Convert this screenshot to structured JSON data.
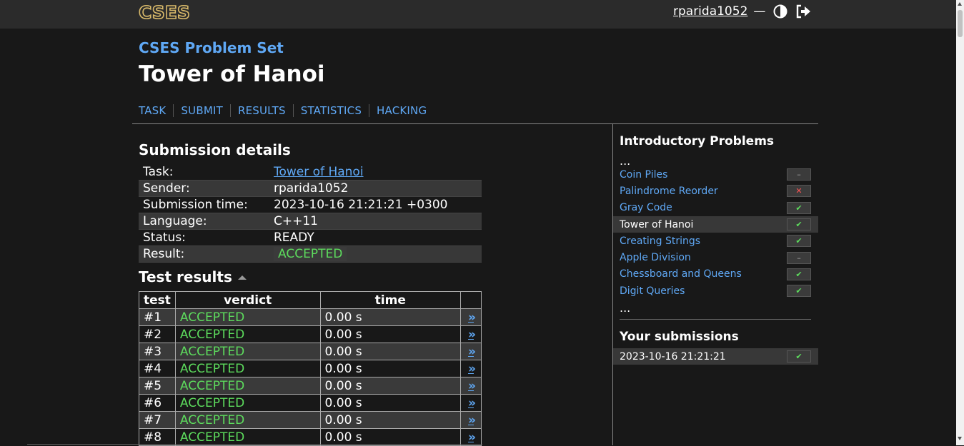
{
  "header": {
    "logo_text": "CSES",
    "username": "rparida1052",
    "dash": "—",
    "theme_icon": "contrast-icon",
    "logout_icon": "logout-icon"
  },
  "section_title": "CSES Problem Set",
  "page_title": "Tower of Hanoi",
  "nav": [
    "TASK",
    "SUBMIT",
    "RESULTS",
    "STATISTICS",
    "HACKING"
  ],
  "details": {
    "heading": "Submission details",
    "rows": [
      {
        "key": "Task:",
        "value": "Tower of Hanoi"
      },
      {
        "key": "Sender:",
        "value": "rparida1052"
      },
      {
        "key": "Submission time:",
        "value": "2023-10-16 21:21:21 +0300"
      },
      {
        "key": "Language:",
        "value": "C++11"
      },
      {
        "key": "Status:",
        "value": "READY"
      },
      {
        "key": "Result:",
        "value": "ACCEPTED"
      }
    ]
  },
  "tests": {
    "heading": "Test results",
    "columns": [
      "test",
      "verdict",
      "time",
      ""
    ],
    "rows": [
      {
        "test": "#1",
        "verdict": "ACCEPTED",
        "time": "0.00 s"
      },
      {
        "test": "#2",
        "verdict": "ACCEPTED",
        "time": "0.00 s"
      },
      {
        "test": "#3",
        "verdict": "ACCEPTED",
        "time": "0.00 s"
      },
      {
        "test": "#4",
        "verdict": "ACCEPTED",
        "time": "0.00 s"
      },
      {
        "test": "#5",
        "verdict": "ACCEPTED",
        "time": "0.00 s"
      },
      {
        "test": "#6",
        "verdict": "ACCEPTED",
        "time": "0.00 s"
      },
      {
        "test": "#7",
        "verdict": "ACCEPTED",
        "time": "0.00 s"
      },
      {
        "test": "#8",
        "verdict": "ACCEPTED",
        "time": "0.00 s"
      }
    ],
    "arrow": "»"
  },
  "sidebar": {
    "heading": "Introductory Problems",
    "dots": "...",
    "items": [
      {
        "label": "Coin Piles",
        "status": "none",
        "mark": "–"
      },
      {
        "label": "Palindrome Reorder",
        "status": "fail",
        "mark": "✕"
      },
      {
        "label": "Gray Code",
        "status": "ok",
        "mark": "✔"
      },
      {
        "label": "Tower of Hanoi",
        "status": "ok",
        "mark": "✔"
      },
      {
        "label": "Creating Strings",
        "status": "ok",
        "mark": "✔"
      },
      {
        "label": "Apple Division",
        "status": "none",
        "mark": "–"
      },
      {
        "label": "Chessboard and Queens",
        "status": "ok",
        "mark": "✔"
      },
      {
        "label": "Digit Queries",
        "status": "ok",
        "mark": "✔"
      }
    ],
    "submissions_heading": "Your submissions",
    "submissions": [
      {
        "time": "2023-10-16 21:21:21",
        "status": "ok",
        "mark": "✔"
      }
    ]
  },
  "colors": {
    "link": "#5fa8f5",
    "accepted": "#5ddc5d",
    "fail": "#ff5555",
    "background": "#181818",
    "header": "#2b2b2b"
  }
}
